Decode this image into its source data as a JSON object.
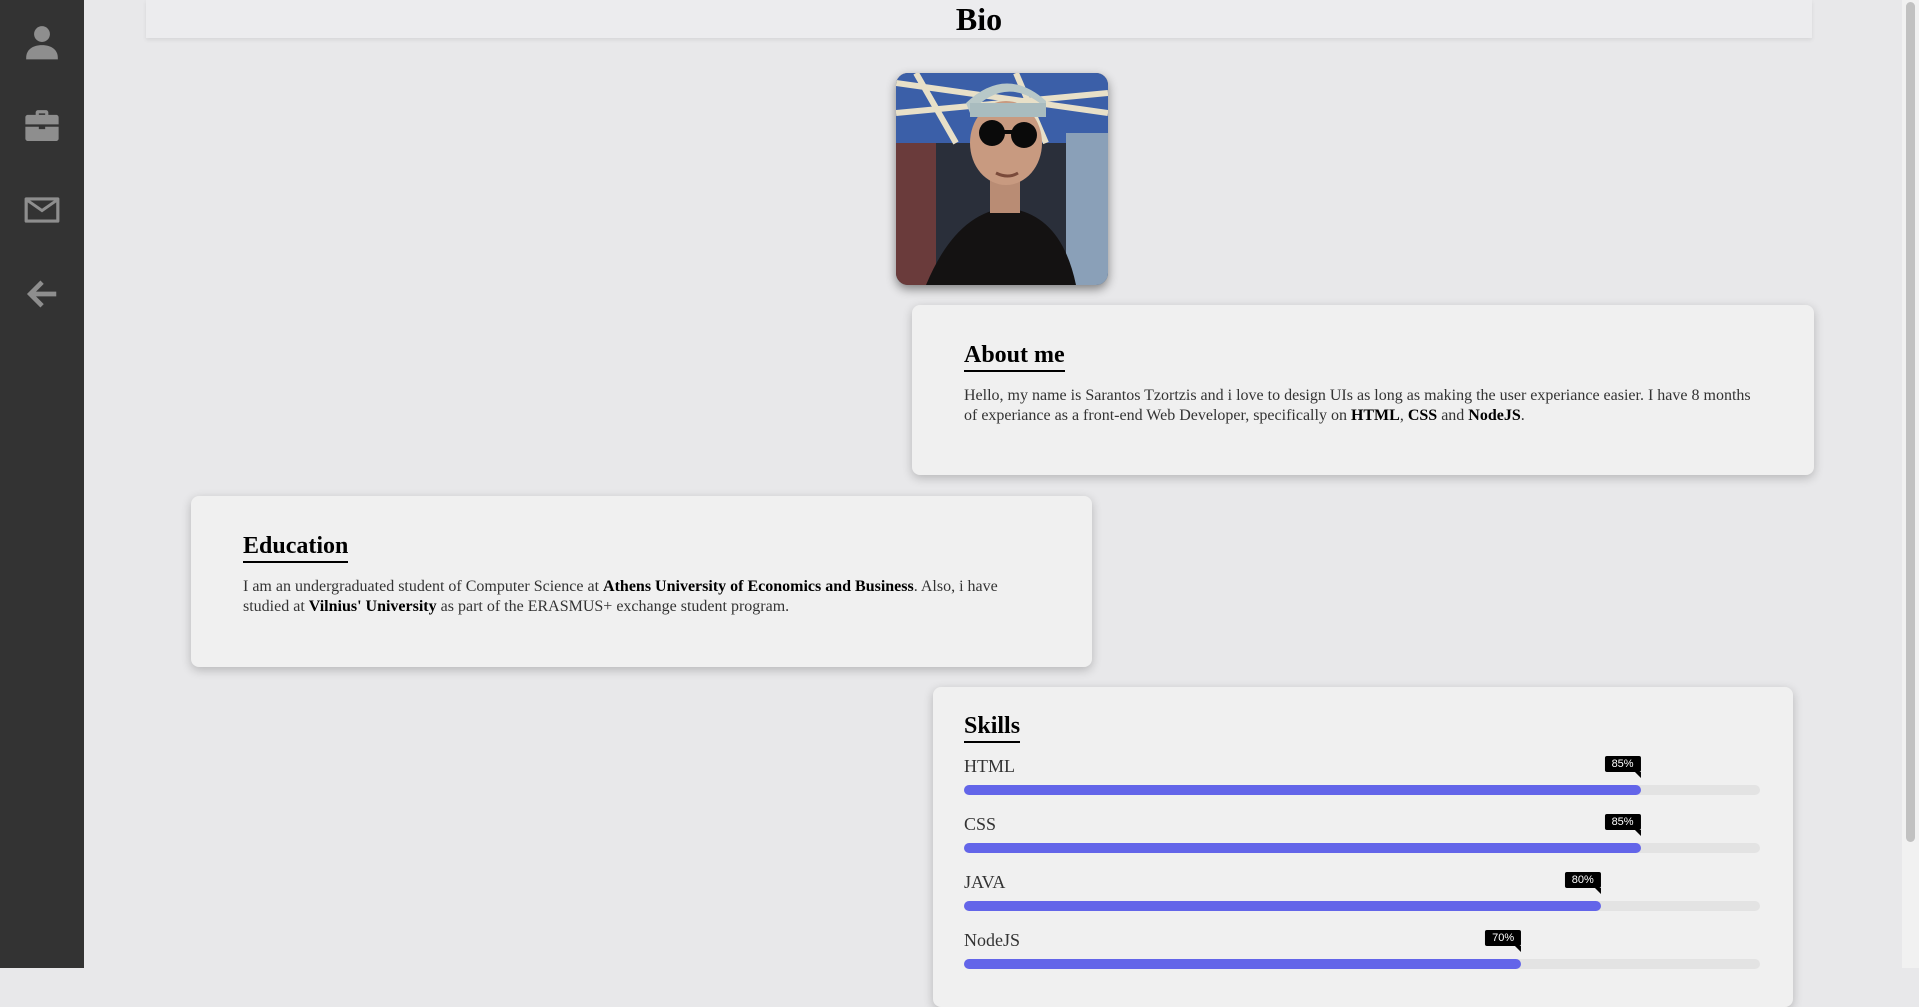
{
  "nav": {
    "items": [
      {
        "name": "profile",
        "icon": "user-icon"
      },
      {
        "name": "portfolio",
        "icon": "briefcase-icon"
      },
      {
        "name": "contact",
        "icon": "envelope-icon"
      },
      {
        "name": "back",
        "icon": "arrow-left-icon"
      }
    ]
  },
  "header": {
    "title": "Bio"
  },
  "photo": {
    "icon": "profile-photo"
  },
  "about": {
    "heading": "About me",
    "text_before": "Hello, my name is Sarantos Tzortzis and i love to design UIs as long as making the user experiance easier. I have 8 months of experiance as a front-end Web Developer, specifically on ",
    "strong_1": "HTML",
    "sep_1": ", ",
    "strong_2": "CSS",
    "sep_2": " and ",
    "strong_3": "NodeJS",
    "text_after": "."
  },
  "education": {
    "heading": "Education",
    "text_before": "I am an undergraduated student of Computer Science at ",
    "strong_1": "Athens University of Economics and Business",
    "text_middle": ". Also, i have studied at ",
    "strong_2": "Vilnius' University",
    "text_after": " as part of the ERASMUS+ exchange student program."
  },
  "skills": {
    "heading": "Skills",
    "items": [
      {
        "name": "HTML",
        "percent_label": "85%",
        "value": 85
      },
      {
        "name": "CSS",
        "percent_label": "85%",
        "value": 85
      },
      {
        "name": "JAVA",
        "percent_label": "80%",
        "value": 80
      },
      {
        "name": "NodeJS",
        "percent_label": "70%",
        "value": 70
      }
    ],
    "bar_color": "#6365e9"
  }
}
